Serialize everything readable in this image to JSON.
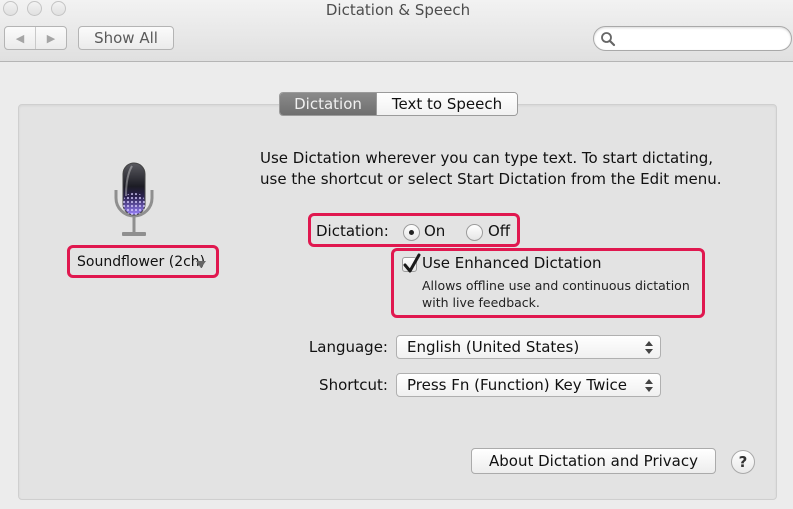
{
  "window": {
    "title": "Dictation & Speech",
    "traffic_lights": [
      "close",
      "minimize",
      "zoom"
    ]
  },
  "toolbar": {
    "back_icon": "triangle-left-icon",
    "forward_icon": "triangle-right-icon",
    "show_all_label": "Show All",
    "search_placeholder": "",
    "search_icon": "magnifier-icon"
  },
  "tabs": [
    {
      "label": "Dictation",
      "active": true
    },
    {
      "label": "Text to Speech",
      "active": false
    }
  ],
  "dictation": {
    "mic_icon": "microphone-icon",
    "input_device": "Soundflower (2ch)",
    "intro": "Use Dictation wherever you can type text. To start dictating, use the shortcut or select Start Dictation from the Edit menu.",
    "dictation_label": "Dictation:",
    "radio_on_label": "On",
    "radio_off_label": "Off",
    "selected": "On",
    "enhanced_label": "Use Enhanced Dictation",
    "enhanced_checked": true,
    "enhanced_desc": "Allows offline use and continuous dictation with live feedback.",
    "language_label": "Language:",
    "language_value": "English (United States)",
    "shortcut_label": "Shortcut:",
    "shortcut_value": "Press Fn (Function) Key Twice",
    "about_button": "About Dictation and Privacy",
    "help_button": "?"
  },
  "colors": {
    "annotation": "#e0184f",
    "active_tab": "#7a7a7a",
    "mic_glow": "#8a6cf0"
  }
}
